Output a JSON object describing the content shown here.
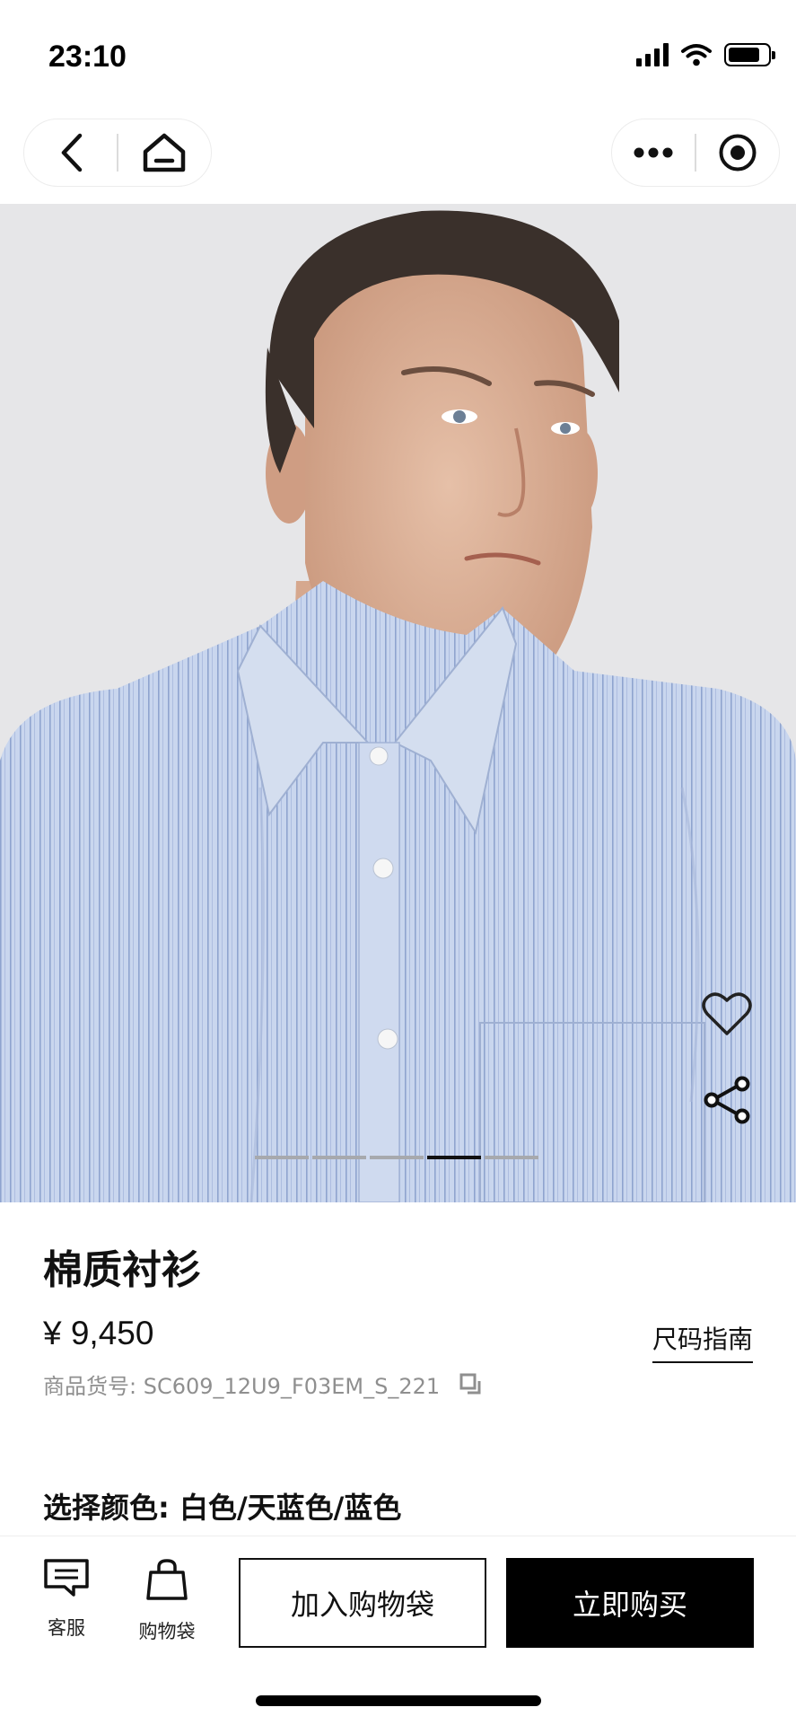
{
  "status_bar": {
    "time": "23:10"
  },
  "nav": {
    "back_icon": "chevron-left-icon",
    "home_icon": "home-icon",
    "more_icon": "more-dots-icon",
    "close_icon": "target-circle-icon"
  },
  "gallery": {
    "image_count": 5,
    "active_index": 3,
    "actions": [
      "heart-icon",
      "share-icon"
    ]
  },
  "product": {
    "title": "棉质衬衫",
    "price": "¥ 9,450",
    "size_guide": "尺码指南",
    "sku": "商品货号: SC609_12U9_F03EM_S_221",
    "color_label": "选择颜色: 白色/天蓝色/蓝色"
  },
  "bottom_bar": {
    "service_label": "客服",
    "bag_label": "购物袋",
    "add_to_bag": "加入购物袋",
    "buy_now": "立即购买"
  },
  "colors": {
    "background": "#ffffff",
    "hero_bg": "#e6e6e8",
    "primary": "#000000",
    "muted_text": "#8f8f8f",
    "shirt": "#c6d4ec"
  }
}
